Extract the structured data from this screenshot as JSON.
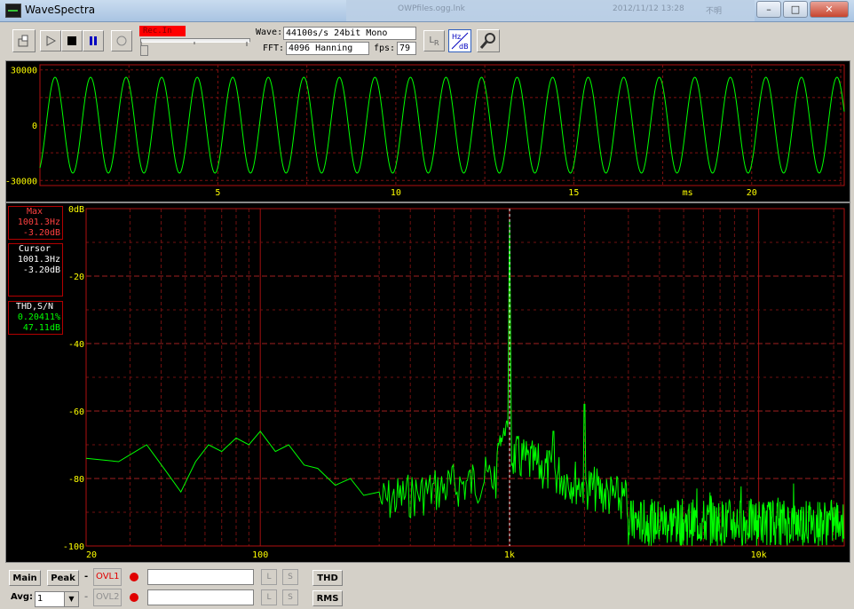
{
  "window": {
    "title": "WaveSpectra",
    "background_tab": [
      "OWPfiles.ogg.lnk",
      "2012/11/12 13:28",
      "不明"
    ],
    "buttons": [
      "minimize",
      "maximize",
      "close"
    ]
  },
  "toolbar": {
    "rec_label": "Rec.In",
    "wave_label": "Wave:",
    "wave_value": "44100s/s 24bit Mono",
    "fft_label": "FFT:",
    "fft_value": "4096 Hanning",
    "fps_label": "fps:",
    "fps_value": "79",
    "icons": [
      "load-icon",
      "play-icon",
      "stop-icon",
      "pause-icon",
      "record-icon",
      "lr-icon",
      "hz-db-icon",
      "settings-icon"
    ],
    "hz_db_label_top": "Hz",
    "hz_db_label_bottom": "dB",
    "lr_label_l": "L",
    "lr_label_r": "R"
  },
  "waveform": {
    "y_ticks": [
      "30000",
      "0",
      "-30000"
    ],
    "x_ticks": [
      "5",
      "10",
      "15",
      "20"
    ],
    "x_unit": "ms",
    "amplitude": 26000,
    "frequency_hz": 1001.3,
    "x_range_ms": [
      0,
      22.6
    ],
    "y_range": [
      -32768,
      32768
    ],
    "line_color": "#00ff00"
  },
  "spectrum": {
    "y_ticks": [
      "0dB",
      "-20",
      "-40",
      "-60",
      "-80",
      "-100"
    ],
    "x_ticks": [
      "20",
      "100",
      "1k",
      "10k"
    ],
    "x_range_hz": [
      20,
      22050
    ],
    "y_range_db": [
      -100,
      0
    ],
    "peak_hz": 1001.3,
    "peak_db": -3.2,
    "line_color": "#00ff00",
    "grid_color": "#a01010",
    "cursor_color": "#ffffff"
  },
  "readouts": {
    "max": {
      "header": "Max",
      "freq": "1001.3Hz",
      "level": "-3.20dB"
    },
    "cursor": {
      "header": "Cursor",
      "freq": "1001.3Hz",
      "level": "-3.20dB"
    },
    "thd": {
      "header": "THD,S/N",
      "thd": "0.20411%",
      "sn": "47.11dB"
    }
  },
  "bottom": {
    "main_label": "Main",
    "peak_label": "Peak",
    "ovl1_label": "OVL1",
    "ovl2_label": "OVL2",
    "dash": "-",
    "avg_label": "Avg:",
    "avg_value": "1",
    "l_label": "L",
    "s_label": "S",
    "thd_label": "THD",
    "rms_label": "RMS"
  }
}
